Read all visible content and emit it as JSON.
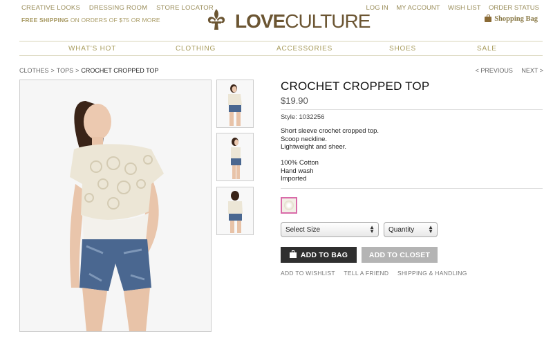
{
  "header": {
    "top_links_left": [
      "CREATIVE LOOKS",
      "DRESSING ROOM",
      "STORE LOCATOR"
    ],
    "free_shipping_bold": "FREE SHIPPING",
    "free_shipping_rest": "ON ORDERS OF $75 OR MORE",
    "logo_bold": "LOVE",
    "logo_thin": "CULTURE",
    "top_links_right": [
      "LOG IN",
      "MY ACCOUNT",
      "WISH LIST",
      "ORDER STATUS"
    ],
    "bag_label": "Shopping Bag"
  },
  "nav": {
    "items": [
      "WHAT'S HOT",
      "CLOTHING",
      "ACCESSORIES",
      "SHOES",
      "SALE"
    ]
  },
  "breadcrumb": {
    "items": [
      "CLOTHES",
      "TOPS",
      "CROCHET CROPPED TOP"
    ],
    "prev": "< PREVIOUS",
    "next": "NEXT >"
  },
  "product": {
    "title": "CROCHET CROPPED TOP",
    "price": "$19.90",
    "style": "Style: 1032256",
    "desc_lines": [
      "Short sleeve crochet cropped top.",
      "Scoop neckline.",
      "Lightweight and sheer."
    ],
    "detail_lines": [
      "100% Cotton",
      "Hand wash",
      "Imported"
    ],
    "size_select": "Select Size",
    "qty_select": "Quantity",
    "add_to_bag": "ADD TO BAG",
    "add_to_closet": "ADD TO CLOSET",
    "links": [
      "ADD TO WISHLIST",
      "TELL A FRIEND",
      "SHIPPING & HANDLING"
    ]
  },
  "colors": {
    "accent": "#a89c5d",
    "logo": "#6b5532",
    "button_dark": "#2f2f2f",
    "button_gray": "#b4b4b4",
    "swatch_border": "#d96ba9"
  }
}
